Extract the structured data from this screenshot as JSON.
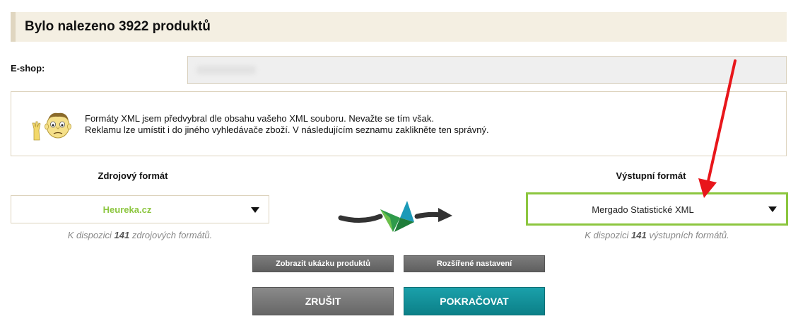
{
  "header": {
    "title": "Bylo nalezeno 3922 produktů"
  },
  "eshop": {
    "label": "E-shop:"
  },
  "info": {
    "line1": "Formáty XML jsem předvybral dle obsahu vašeho XML souboru. Nevažte se tím však.",
    "line2": "Reklamu lze umístit i do jiného vyhledávače zboží. V následujícím seznamu zaklikněte ten správný."
  },
  "source": {
    "title": "Zdrojový formát",
    "selected": "Heureka.cz",
    "available_prefix": "K dispozici",
    "available_count": "141",
    "available_suffix": "zdrojových formátů."
  },
  "output": {
    "title": "Výstupní formát",
    "selected": "Mergado Statistické XML",
    "available_prefix": "K dispozici",
    "available_count": "141",
    "available_suffix": "výstupních formátů."
  },
  "buttons": {
    "preview": "Zobrazit ukázku produktů",
    "advanced": "Rozšířené nastavení",
    "cancel": "ZRUŠIT",
    "continue": "POKRAČOVAT"
  },
  "icons": {
    "mascot": "mascot-icon",
    "transform": "transform-arrow-icon",
    "annotation": "red-arrow-annotation",
    "dropdown": "chevron-down-icon"
  },
  "colors": {
    "header_bg": "#f4efe2",
    "accent_green": "#8cc63f",
    "continue_teal": "#128d96",
    "button_gray": "#6a6a6a",
    "annotation_red": "#e8161b"
  }
}
